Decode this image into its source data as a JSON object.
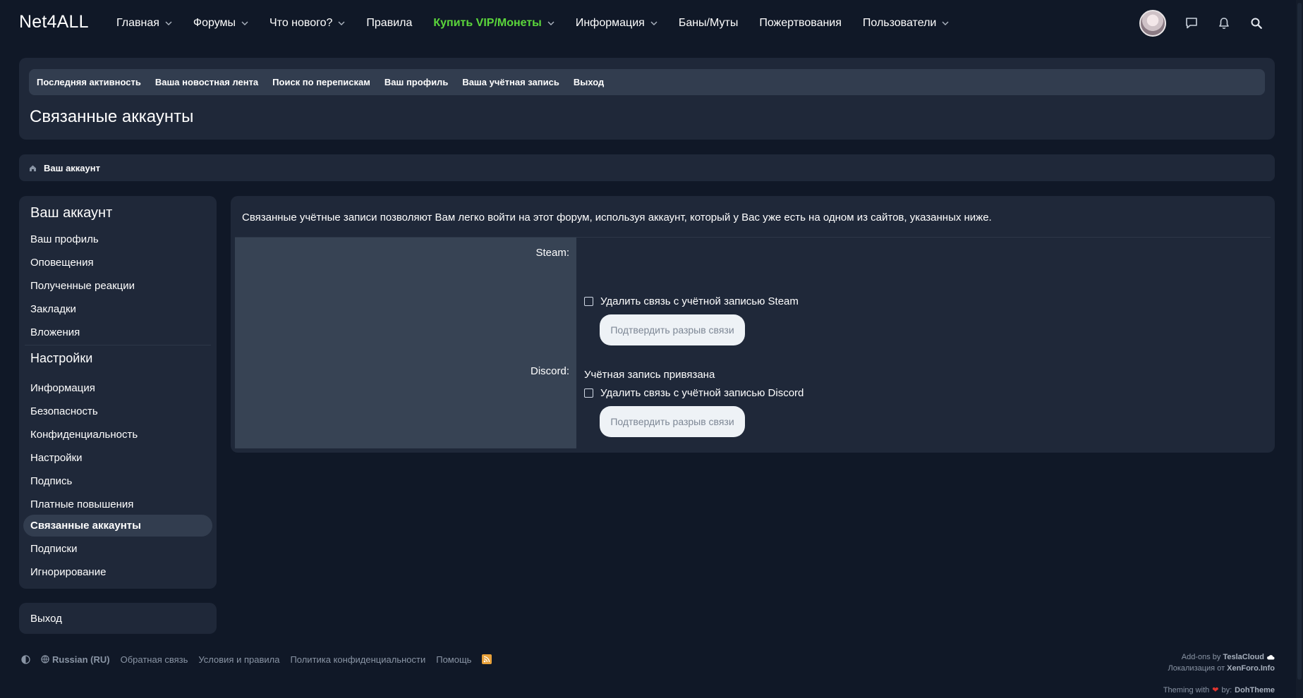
{
  "logo": "Net4ALL",
  "nav": {
    "items": [
      {
        "label": "Главная",
        "dropdown": true
      },
      {
        "label": "Форумы",
        "dropdown": true
      },
      {
        "label": "Что нового?",
        "dropdown": true
      },
      {
        "label": "Правила",
        "dropdown": false
      },
      {
        "label": "Купить VIP/Монеты",
        "dropdown": true,
        "highlight": true
      },
      {
        "label": "Информация",
        "dropdown": true
      },
      {
        "label": "Баны/Муты",
        "dropdown": false
      },
      {
        "label": "Пожертвования",
        "dropdown": false
      },
      {
        "label": "Пользователи",
        "dropdown": true
      }
    ],
    "icons": [
      "avatar",
      "chat-icon",
      "bell-icon",
      "search-icon"
    ]
  },
  "subnav": {
    "items": [
      "Последняя активность",
      "Ваша новостная лента",
      "Поиск по перепискам",
      "Ваш профиль",
      "Ваша учётная запись",
      "Выход"
    ]
  },
  "page_title": "Связанные аккаунты",
  "breadcrumb": {
    "label": "Ваш аккаунт"
  },
  "sidebar": {
    "heading_account": "Ваш аккаунт",
    "account_items": [
      "Ваш профиль",
      "Оповещения",
      "Полученные реакции",
      "Закладки",
      "Вложения"
    ],
    "heading_settings": "Настройки",
    "settings_items": [
      "Информация",
      "Безопасность",
      "Конфиденциальность",
      "Настройки",
      "Подпись",
      "Платные повышения",
      "Связанные аккаунты",
      "Подписки",
      "Игнорирование"
    ],
    "active_item": "Связанные аккаунты",
    "logout": "Выход"
  },
  "main": {
    "intro": "Связанные учётные записи позволяют Вам легко войти на этот форум, используя аккаунт, который у Вас уже есть на одном из сайтов, указанных ниже.",
    "steam": {
      "label": "Steam:",
      "unlink_label": "Удалить связь с учётной записью Steam",
      "confirm_button": "Подтвердить разрыв связи"
    },
    "discord": {
      "label": "Discord:",
      "status": "Учётная запись привязана",
      "unlink_label": "Удалить связь с учётной записью Discord",
      "confirm_button": "Подтвердить разрыв связи"
    }
  },
  "footer": {
    "language": "Russian (RU)",
    "links": [
      "Обратная связь",
      "Условия и правила",
      "Политика конфиденциальности",
      "Помощь"
    ],
    "addons_prefix": "Add-ons by",
    "addons_name": "TeslaCloud",
    "localization_prefix": "Локализация от",
    "localization_name": "XenForo.Info",
    "theming_prefix": "Theming with",
    "theming_by": "by:",
    "theming_name": "DohTheme"
  },
  "colors": {
    "background": "#101827",
    "panel": "#1f2839",
    "vip": "#5bd63b"
  }
}
